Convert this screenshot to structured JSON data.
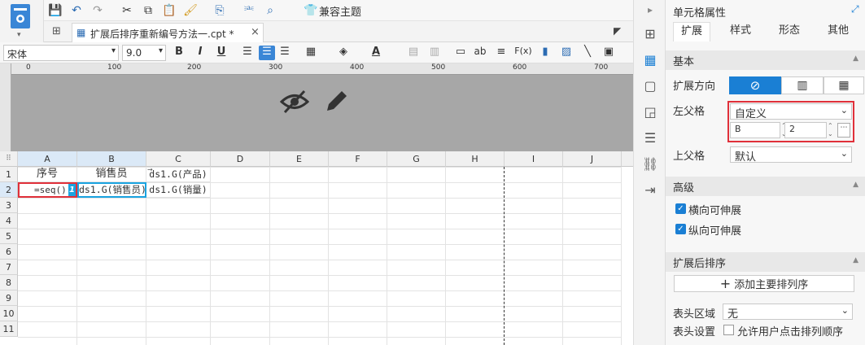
{
  "toolbar": {
    "compat_theme": "兼容主题"
  },
  "tab": {
    "title": "扩展后排序重新编号方法一.cpt *",
    "close": "×"
  },
  "format": {
    "font": "宋体",
    "size": "9.0",
    "bold": "B",
    "italic": "I",
    "underline": "U",
    "ab": "ab",
    "fx": "F(x)"
  },
  "ruler": {
    "ticks": [
      "0",
      "100",
      "200",
      "300",
      "400",
      "500",
      "600",
      "700"
    ]
  },
  "grid": {
    "columns": [
      "A",
      "B",
      "C",
      "D",
      "E",
      "F",
      "G",
      "H",
      "I",
      "J"
    ],
    "rows": [
      "1",
      "2",
      "3",
      "4",
      "5",
      "6",
      "7",
      "8",
      "9",
      "10",
      "11"
    ],
    "cells": {
      "A1": "序号",
      "B1": "销售员",
      "C1": "ds1.G(产品)",
      "A2": "=seq()",
      "B2": "ds1.G(销售员)",
      "C2": "ds1.G(销量)",
      "A2_badge": "1"
    }
  },
  "panel": {
    "title": "单元格属性",
    "tabs": [
      "扩展",
      "样式",
      "形态",
      "其他"
    ],
    "basic": "基本",
    "expand_dir": "扩展方向",
    "left_parent": "左父格",
    "left_parent_value": "自定义",
    "left_col": "B",
    "left_row": "2",
    "upper_parent": "上父格",
    "upper_parent_value": "默认",
    "advanced": "高级",
    "h_stretch": "横向可伸展",
    "v_stretch": "纵向可伸展",
    "sort_after": "扩展后排序",
    "add_sort": "添加主要排列序",
    "header_area": "表头区域",
    "header_area_value": "无",
    "header_setting": "表头设置",
    "allow_click_sort": "允许用户点击排列顺序"
  },
  "colors": {
    "accent": "#1a7fd4",
    "highlight": "#e0303a"
  }
}
